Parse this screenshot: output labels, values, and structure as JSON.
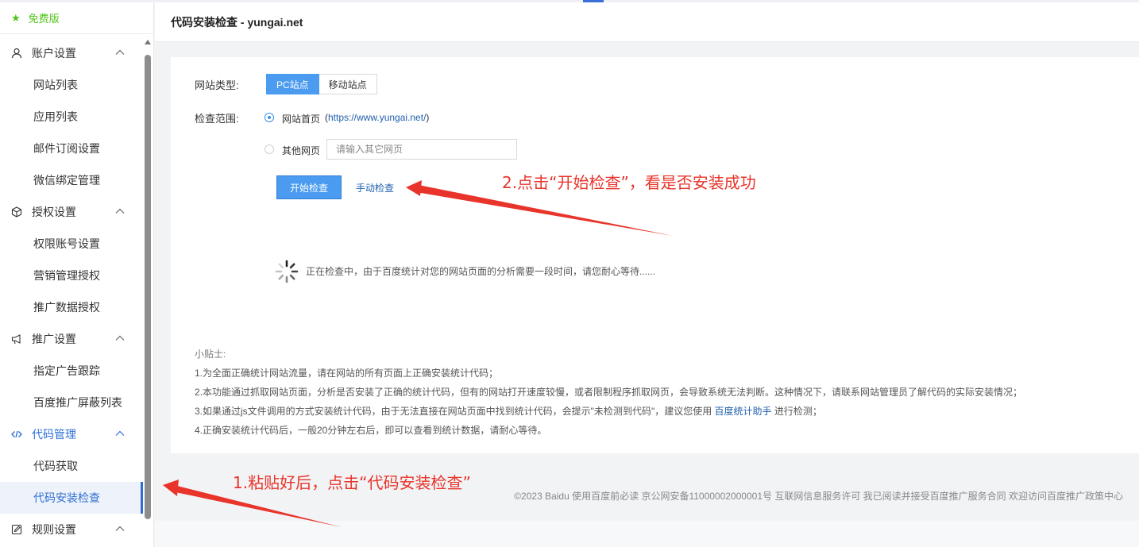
{
  "sidebar": {
    "free_label": "免费版",
    "groups": [
      {
        "label": "账户设置",
        "icon": "user-icon",
        "items": [
          "网站列表",
          "应用列表",
          "邮件订阅设置",
          "微信绑定管理"
        ]
      },
      {
        "label": "授权设置",
        "icon": "cube-icon",
        "items": [
          "权限账号设置",
          "营销管理授权",
          "推广数据授权"
        ]
      },
      {
        "label": "推广设置",
        "icon": "megaphone-icon",
        "items": [
          "指定广告跟踪",
          "百度推广屏蔽列表"
        ]
      },
      {
        "label": "代码管理",
        "icon": "code-icon",
        "items": [
          "代码获取",
          "代码安装检查"
        ]
      },
      {
        "label": "规则设置",
        "icon": "edit-icon",
        "items": []
      }
    ],
    "selected_item": "代码安装检查",
    "active_group": "代码管理",
    "accent_color": "#2f6fd3",
    "free_color": "#52c41a"
  },
  "header": {
    "title": "代码安装检查 - yungai.net"
  },
  "form": {
    "site_type_label": "网站类型:",
    "site_type_options": [
      "PC站点",
      "移动站点"
    ],
    "site_type_selected": "PC站点",
    "scope_label": "检查范围:",
    "scope_homepage_label": "网站首页",
    "scope_homepage_url_open": "(",
    "scope_homepage_url": "https://www.yungai.net/",
    "scope_homepage_url_close": ")",
    "scope_other_label": "其他网页",
    "scope_other_placeholder": "请输入其它网页",
    "scope_selected": "网站首页",
    "start_button": "开始检查",
    "manual_link": "手动检查"
  },
  "status": {
    "checking_text": "正在检查中，由于百度统计对您的网站页面的分析需要一段时间，请您耐心等待......"
  },
  "tips": {
    "title": "小贴士:",
    "line1": "1.为全面正确统计网站流量，请在网站的所有页面上正确安装统计代码；",
    "line2": "2.本功能通过抓取网站页面，分析是否安装了正确的统计代码，但有的网站打开速度较慢，或者限制程序抓取网页，会导致系统无法判断。这种情况下，请联系网站管理员了解代码的实际安装情况；",
    "line3_before": "3.如果通过js文件调用的方式安装统计代码，由于无法直接在网站页面中找到统计代码，会提示\"未检测到代码\"，建议您使用",
    "line3_link": "百度统计助手",
    "line3_after": "进行检测；",
    "line4": "4.正确安装统计代码后，一般20分钟左右后，即可以查看到统计数据，请耐心等待。"
  },
  "footer": {
    "text": "©2023 Baidu 使用百度前必读 京公网安备11000002000001号 互联网信息服务许可 我已阅读并接受百度推广服务合同 欢迎访问百度推广政策中心"
  },
  "annotations": {
    "step2": "2.点击“开始检查”，看是否安装成功",
    "step1": "1.粘贴好后，点击“代码安装检查”",
    "color": "#e8342a"
  },
  "colors": {
    "primary_button": "#4b9bf0",
    "link": "#1f5fae"
  }
}
